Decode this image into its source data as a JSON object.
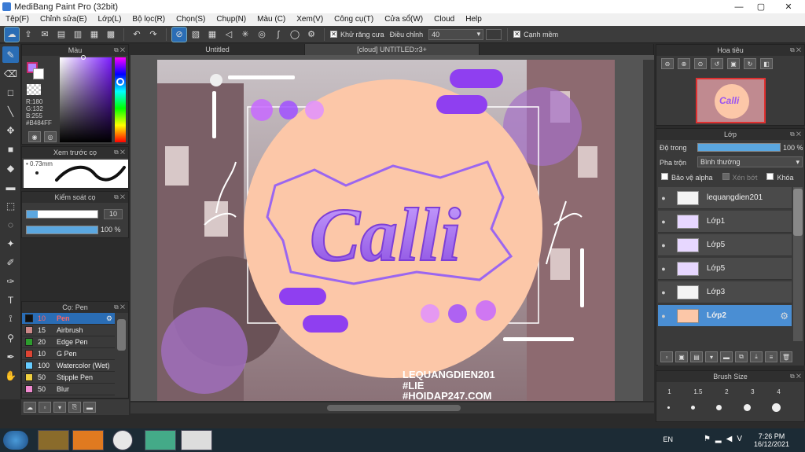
{
  "window": {
    "title": "MediBang Paint Pro (32bit)",
    "min": "—",
    "max": "▢",
    "close": "✕"
  },
  "menu": [
    "Tệp(F)",
    "Chỉnh sửa(E)",
    "Lớp(L)",
    "Bộ lọc(R)",
    "Chọn(S)",
    "Chụp(N)",
    "Màu (C)",
    "Xem(V)",
    "Công cụ(T)",
    "Cửa sổ(W)",
    "Cloud",
    "Help"
  ],
  "toolbar": {
    "antialias_label": "Khử răng cưa",
    "correction_label": "Điều chỉnh",
    "correction_value": "40",
    "sharpen_label": "Cạnh mềm",
    "antialias_check": "✕",
    "sharpen_check": "✕"
  },
  "tabs": [
    "Untitled",
    "[cloud] UNTITLED:r3+",
    ""
  ],
  "color_panel": {
    "title": "Màu",
    "r": "R:180",
    "g": "G:132",
    "b": "B:255",
    "hex": "#B484FF"
  },
  "brush_preview": {
    "title": "Xem trước cọ",
    "size": "0.73mm"
  },
  "brush_control": {
    "title": "Kiểm soát cọ",
    "size_value": "10",
    "opacity_value": "100 %"
  },
  "brush_list": {
    "title": "Cọ: Pen",
    "items": [
      {
        "num": "10",
        "name": "Pen",
        "color": "#111111"
      },
      {
        "num": "15",
        "name": "Airbrush",
        "color": "#c88"
      },
      {
        "num": "20",
        "name": "Edge Pen",
        "color": "#2d9c2d"
      },
      {
        "num": "10",
        "name": "G Pen",
        "color": "#d43"
      },
      {
        "num": "100",
        "name": "Watercolor (Wet)",
        "color": "#6cf"
      },
      {
        "num": "50",
        "name": "Stipple Pen",
        "color": "#f0d040"
      },
      {
        "num": "50",
        "name": "Blur",
        "color": "#f08ad0"
      }
    ]
  },
  "navigator": {
    "title": "Hoa tiêu"
  },
  "layer_panel": {
    "title": "Lớp",
    "opacity_label": "Độ trong",
    "opacity_value": "100 %",
    "blend_label": "Pha trộn",
    "blend_value": "Bình thường",
    "protect_alpha": "Bảo vệ alpha",
    "clip": "Xén bớt",
    "lock": "Khóa",
    "layers": [
      "lequangdien201",
      "Lớp1",
      "Lớp5",
      "Lớp5",
      "Lớp3",
      "Lớp2"
    ]
  },
  "brush_size": {
    "title": "Brush Size",
    "sizes": [
      "1",
      "1.5",
      "2",
      "3",
      "4"
    ]
  },
  "canvas": {
    "logo": "Calli",
    "watermark1": "LEQUANGDIEN201",
    "watermark2": "#LIE",
    "watermark3": "#HOIDAP247.COM"
  },
  "taskbar": {
    "lang": "EN",
    "time": "7:26 PM",
    "date": "16/12/2021"
  }
}
